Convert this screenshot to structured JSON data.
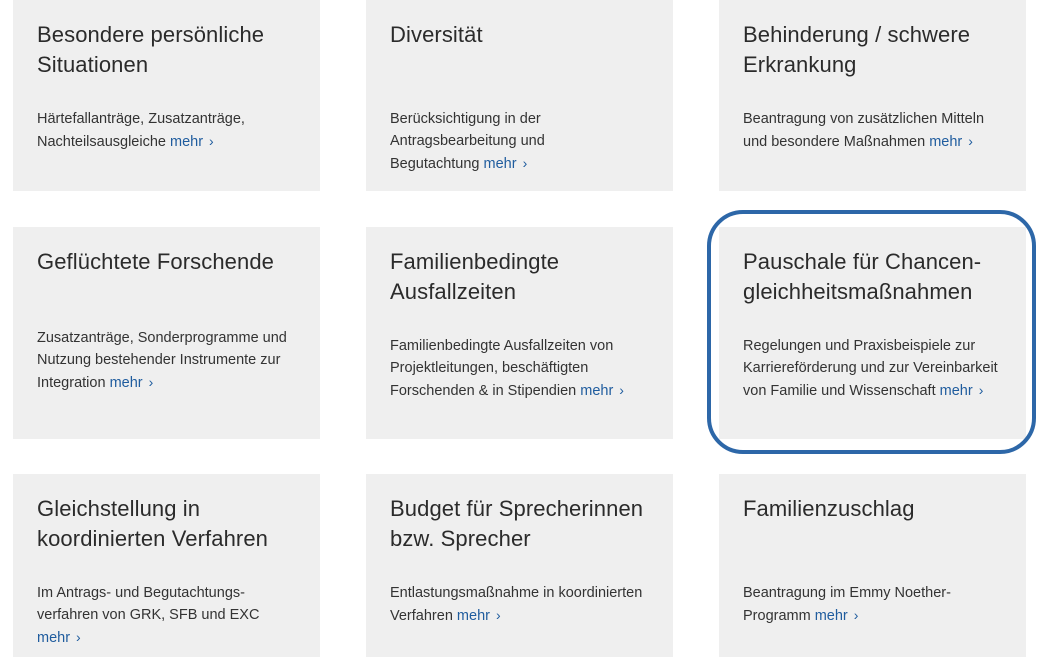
{
  "more_label": "mehr",
  "chevron": "›",
  "accent_color": "#1f5c9e",
  "highlight_color": "#2d67a8",
  "cards": [
    {
      "title": "Besondere persönliche Situationen",
      "description": "Härtefallanträge, Zusatzanträge, Nachteilsausgleiche"
    },
    {
      "title": "Diversität",
      "description": "Berücksichtigung in der Antragsbearbeitung und Begutachtung"
    },
    {
      "title": "Behinderung / schwere Erkrankung",
      "description": "Beantragung von zusätzlichen Mitteln und besondere Maßnahmen"
    },
    {
      "title": "Geflüchtete Forschende",
      "description": "Zusatzanträge, Sonderprogramme und Nutzung bestehender Instrumente zur Integration"
    },
    {
      "title": "Familienbedingte Ausfallzeiten",
      "description": "Familienbedingte Ausfallzeiten von Projektleitungen, beschäftigten Forschenden & in Stipendien"
    },
    {
      "title": "Pauschale für Chancen-gleichheitsmaßnahmen",
      "description": "Regelungen und Praxisbeispiele zur Karriereförderung und zur Vereinbarkeit von Familie und Wissenschaft",
      "highlighted": true
    },
    {
      "title": "Gleichstellung in koordinierten Verfahren",
      "description": "Im Antrags- und Begutachtungs-verfahren von GRK, SFB und EXC"
    },
    {
      "title": "Budget für Sprecherinnen bzw. Sprecher",
      "description": "Entlastungsmaßnahme in koordinierten Verfahren"
    },
    {
      "title": "Familienzuschlag",
      "description": "Beantragung im Emmy Noether-Programm"
    }
  ]
}
